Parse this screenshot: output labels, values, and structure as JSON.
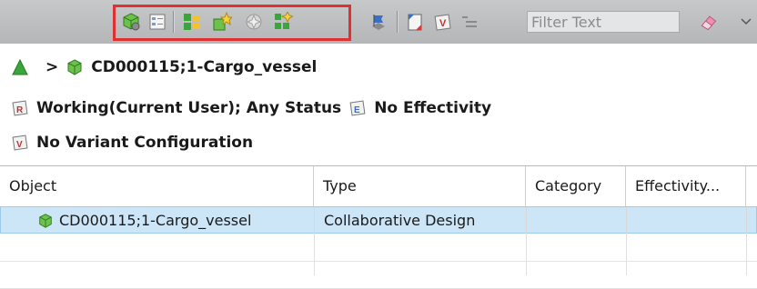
{
  "toolbar": {
    "filter_placeholder": "Filter Text",
    "buttons": [
      {
        "icon": "cube-gear-icon"
      },
      {
        "icon": "properties-icon"
      },
      {
        "icon": "structure-tree-icon"
      },
      {
        "icon": "structure-add-icon"
      },
      {
        "icon": "structure-spark-icon"
      },
      {
        "icon": "grid-spark-icon"
      },
      {
        "icon": "object-flag-icon"
      },
      {
        "icon": "paste-icon"
      },
      {
        "icon": "variant-rule-icon"
      },
      {
        "icon": "filter-list-icon"
      },
      {
        "icon": "eraser-icon"
      },
      {
        "icon": "view-menu-icon"
      }
    ]
  },
  "breadcrumb": {
    "home_icon": "green-triangle-icon",
    "separator": ">",
    "item": "CD000115;1-Cargo_vessel"
  },
  "rules": {
    "revision_rule": "Working(Current User); Any Status",
    "effectivity": "No Effectivity",
    "variant": "No Variant Configuration"
  },
  "table": {
    "columns": [
      "Object",
      "Type",
      "Category",
      "Effectivity..."
    ],
    "rows": [
      {
        "object": "CD000115;1-Cargo_vessel",
        "type": "Collaborative Design",
        "category": "",
        "effectivity": ""
      }
    ]
  },
  "colors": {
    "highlight": "#e03030",
    "selection": "#cde6f7",
    "accent_green": "#3aa53a"
  }
}
